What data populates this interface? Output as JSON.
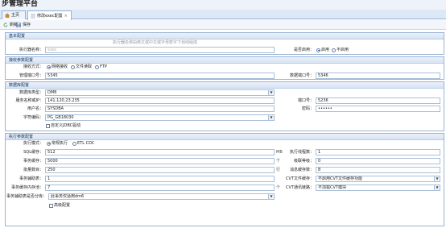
{
  "app": {
    "title": "步管理平台"
  },
  "tabs": [
    {
      "label": "主页",
      "icon": "home-icon"
    },
    {
      "label": "修改exec配置",
      "icon": "document-edit-icon",
      "close": "×"
    }
  ],
  "toolbar": {
    "refresh_label": "刷新",
    "save_label": "保存"
  },
  "basic": {
    "title": "基本配置",
    "hint": "执行器名称由英文或中文或字母数字下划线组成",
    "name_label": "执行器名称：",
    "name_placeholder": "exec",
    "enabled_label": "是否启用：",
    "enabled_options": [
      "启用",
      "不启用"
    ],
    "enabled_value": "启用"
  },
  "recv": {
    "title": "接收参数配置",
    "mode_label": "接收方式：",
    "mode_options": [
      "网络接收",
      "文件读取",
      "FTP"
    ],
    "mode_value": "网络接收",
    "mgmt_port_label": "管理端口号：",
    "mgmt_port": "5345",
    "data_port_label": "数据端口号：",
    "data_port": "5346"
  },
  "db": {
    "title": "数据库配置",
    "type_label": "数据库类型：",
    "type_value": "DM8",
    "server_label": "服务名称或IP：",
    "server_value": "141.120.23.235",
    "port_label": "端口号：",
    "port_value": "5236",
    "user_label": "用户名：",
    "user_value": "SYSDBA",
    "pwd_label": "密码：",
    "pwd_value": "••••••",
    "charset_label": "字符编码：",
    "charset_value": "PG_GB18030",
    "jdbc_label": "自定义JDBC驱动"
  },
  "exec": {
    "title": "执行参数配置",
    "mode_label": "执行模式：",
    "mode_options": [
      "常规执行",
      "ETL CDC"
    ],
    "mode_value": "常规执行",
    "sql_cache_label": "SQL缓存：",
    "sql_cache_value": "512",
    "sql_cache_unit": "MB",
    "threads_label": "执行线程数：",
    "threads_value": "1",
    "trx_cache_label": "事务缓存：",
    "trx_cache_value": "5000",
    "trx_cache_unit": "个",
    "level_label": "级联等级：",
    "level_value": "0",
    "batch_label": "批量数目：",
    "batch_value": "250",
    "batch_unit": "行",
    "msg_cache_label": "消息缓存数：",
    "msg_cache_value": "8",
    "trx_assist_label": "事务辅助表：",
    "trx_assist_value": "1",
    "cvt_file_label": "CVT文件缓存：",
    "cvt_file_value": "不启用CVT文件缓存功能",
    "trx_cache_mem_label": "事务缓存内存池：",
    "trx_cache_mem_value": "7",
    "trx_cache_mem_unit": "个",
    "cvt_lib_label": "CVT通讯链路：",
    "cvt_lib_value": "不加载CVT模块",
    "assist_dist_label": "事务辅助表是否分库：",
    "assist_dist_value": "此事务仅适用dm6",
    "advanced_label": "高级配置"
  }
}
